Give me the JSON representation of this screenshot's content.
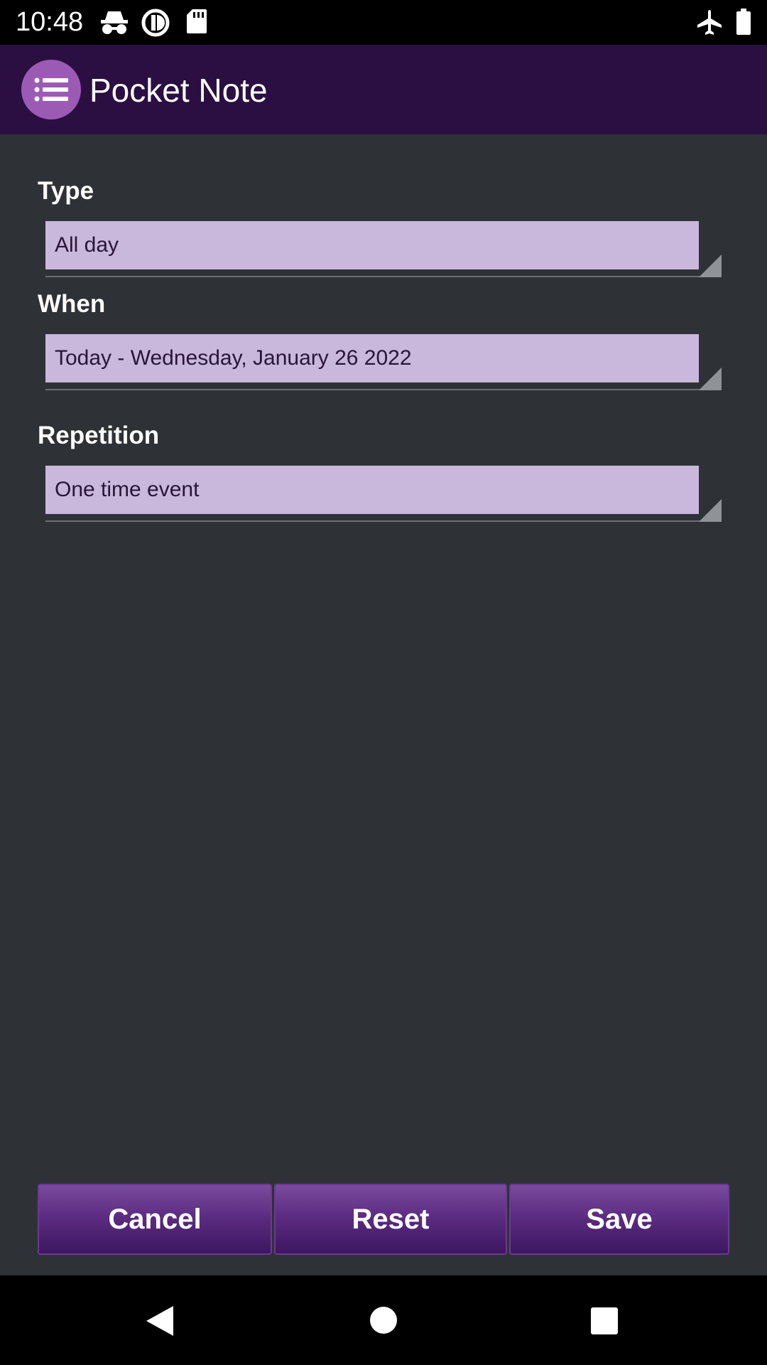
{
  "status_bar": {
    "time": "10:48",
    "icons": [
      "incognito-icon",
      "sync-icon",
      "sd-card-icon",
      "airplane-icon",
      "battery-icon"
    ]
  },
  "app_bar": {
    "title": "Pocket Note",
    "menu_icon": "list-icon"
  },
  "form": {
    "type": {
      "label": "Type",
      "value": "All day"
    },
    "when": {
      "label": "When",
      "value": "Today - Wednesday, January 26 2022"
    },
    "repetition": {
      "label": "Repetition",
      "value": "One time event"
    }
  },
  "buttons": {
    "cancel": "Cancel",
    "reset": "Reset",
    "save": "Save"
  },
  "nav_bar": {
    "icons": [
      "back-icon",
      "home-icon",
      "recents-icon"
    ]
  },
  "colors": {
    "background": "#2e3236",
    "app_bar": "#2b0f42",
    "accent": "#9b5bb5",
    "field_fill": "#c9b7dc",
    "button": "#5c2d82"
  }
}
